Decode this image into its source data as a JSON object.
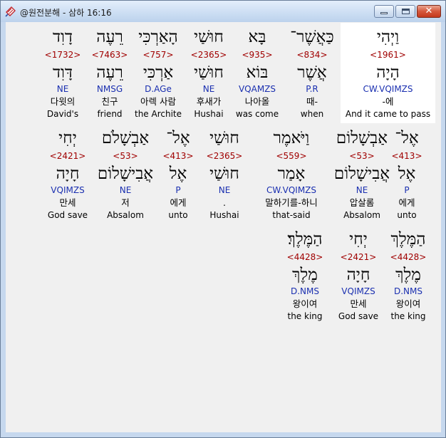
{
  "window": {
    "title": "@원전분해 - 삼하 16:16",
    "close_glyph": "✕"
  },
  "rows": [
    {
      "words": [
        {
          "hebrew": "וַיְהִי",
          "strong": "<1961>",
          "lemma": "הָיָה",
          "parse": "CW.VQIMZS",
          "korean": "-에",
          "english": "And it came to pass"
        },
        {
          "hebrew": "כַּאֲשֶׁר־",
          "strong": "<834>",
          "lemma": "אֲשֶׁר",
          "parse": "P.R",
          "korean": "때-",
          "english": "when"
        },
        {
          "hebrew": "בָּא",
          "strong": "<935>",
          "lemma": "בּוֹא",
          "parse": "VQAMZS",
          "korean": "나아올",
          "english": "was come"
        },
        {
          "hebrew": "חוּשַׁי",
          "strong": "<2365>",
          "lemma": "חוּשַׁי",
          "parse": "NE",
          "korean": "후새가",
          "english": "Hushai"
        },
        {
          "hebrew": "הָאַרְכִּי",
          "strong": "<757>",
          "lemma": "אַרְכִּי",
          "parse": "D.AGe",
          "korean": "아렉 사람",
          "english": "the Archite"
        },
        {
          "hebrew": "רֵעֶה",
          "strong": "<7463>",
          "lemma": "רֵעֶה",
          "parse": "NMSG",
          "korean": "친구",
          "english": "friend"
        },
        {
          "hebrew": "דָוִד",
          "strong": "<1732>",
          "lemma": "דָּוִד",
          "parse": "NE",
          "korean": "다윗의",
          "english": "David's"
        }
      ]
    },
    {
      "words": [
        {
          "hebrew": "אֶל־",
          "strong": "<413>",
          "lemma": "אֶל",
          "parse": "P",
          "korean": "에게",
          "english": "unto"
        },
        {
          "hebrew": "אַבְשָׁלוֹם",
          "strong": "<53>",
          "lemma": "אֲבִישָׁלוֹם",
          "parse": "NE",
          "korean": "압살롬",
          "english": "Absalom"
        },
        {
          "hebrew": "וַיֹּאמֶר",
          "strong": "<559>",
          "lemma": "אָמַר",
          "parse": "CW.VQIMZS",
          "korean": "말하기를-하니",
          "english": "that-said"
        },
        {
          "hebrew": "חוּשַׁי",
          "strong": "<2365>",
          "lemma": "חוּשַׁי",
          "parse": "NE",
          "korean": ".",
          "english": "Hushai"
        },
        {
          "hebrew": "אֶל־",
          "strong": "<413>",
          "lemma": "אֶל",
          "parse": "P",
          "korean": "에게",
          "english": "unto"
        },
        {
          "hebrew": "אַבְשָׁלֹם",
          "strong": "<53>",
          "lemma": "אֲבִישָׁלוֹם",
          "parse": "NE",
          "korean": "저",
          "english": "Absalom"
        },
        {
          "hebrew": "יְחִי",
          "strong": "<2421>",
          "lemma": "חָיָה",
          "parse": "VQIMZS",
          "korean": "만세",
          "english": "God save"
        }
      ]
    },
    {
      "words": [
        {
          "hebrew": "הַמֶּלֶךְ",
          "strong": "<4428>",
          "lemma": "מֶלֶךְ",
          "parse": "D.NMS",
          "korean": "왕이여",
          "english": "the king"
        },
        {
          "hebrew": "יְחִי",
          "strong": "<2421>",
          "lemma": "חָיָה",
          "parse": "VQIMZS",
          "korean": "만세",
          "english": "God save"
        },
        {
          "hebrew": "הַמֶּלֶךְ׃",
          "strong": "<4428>",
          "lemma": "מֶלֶךְ",
          "parse": "D.NMS",
          "korean": "왕이여",
          "english": "the king"
        }
      ]
    }
  ]
}
